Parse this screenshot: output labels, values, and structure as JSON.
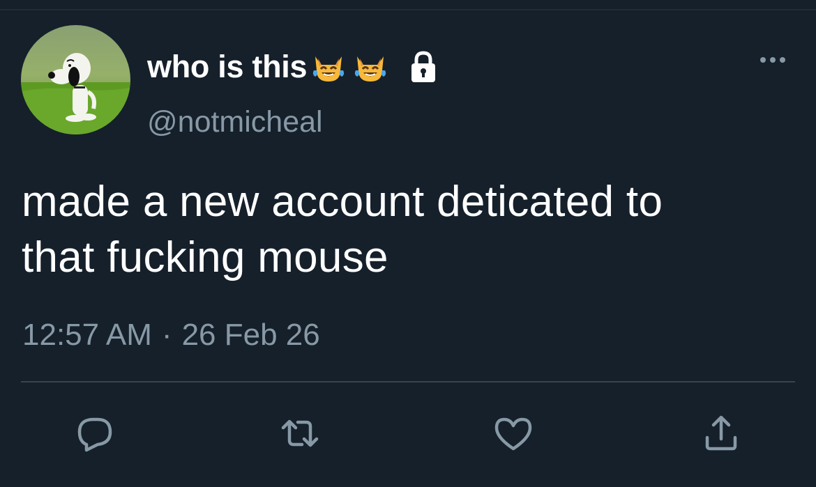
{
  "tweet": {
    "display_name": "who is this",
    "name_emojis": [
      "cat-face-with-tears-of-joy",
      "cat-face-with-tears-of-joy"
    ],
    "protected_icon": "lock-icon",
    "handle": "@notmicheal",
    "text_line1": "made a new account deticated to",
    "text_line2": "that fucking mouse",
    "time": "12:57 AM",
    "separator": "·",
    "date": "26 Feb 26"
  },
  "actions": {
    "reply_icon": "reply-icon",
    "retweet_icon": "retweet-icon",
    "like_icon": "heart-icon",
    "share_icon": "share-icon"
  },
  "colors": {
    "background": "#15202b",
    "primary_text": "#ffffff",
    "secondary_text": "#8899a6",
    "divider": "#38444d"
  }
}
